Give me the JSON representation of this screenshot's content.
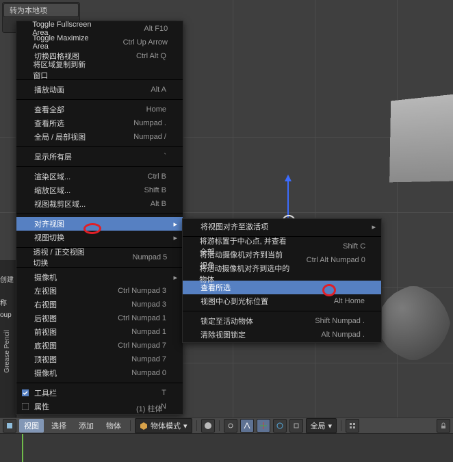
{
  "panel": {
    "title": "转为本地项"
  },
  "menu": {
    "items": [
      {
        "label": "Toggle Fullscreen Area",
        "shortcut": "Alt F10"
      },
      {
        "label": "Toggle Maximize Area",
        "shortcut": "Ctrl Up Arrow"
      },
      {
        "label": "切换四格视图",
        "shortcut": "Ctrl Alt Q"
      },
      {
        "label": "将区域复制到新窗口",
        "shortcut": ""
      },
      null,
      {
        "label": "播放动画",
        "shortcut": "Alt A"
      },
      null,
      {
        "label": "查看全部",
        "shortcut": "Home"
      },
      {
        "label": "查看所选",
        "shortcut": "Numpad ."
      },
      {
        "label": "全局 / 局部视图",
        "shortcut": "Numpad /"
      },
      null,
      {
        "label": "显示所有层",
        "shortcut": "`"
      },
      null,
      {
        "label": "渲染区域...",
        "shortcut": "Ctrl B"
      },
      {
        "label": "缩放区域...",
        "shortcut": "Shift B"
      },
      {
        "label": "视图裁剪区域...",
        "shortcut": "Alt B"
      },
      null,
      {
        "label": "对齐视图",
        "shortcut": "",
        "arrow": true,
        "highlight": true
      },
      {
        "label": "视图切换",
        "shortcut": "",
        "arrow": true
      },
      null,
      {
        "label": "透视 / 正交视图切换",
        "shortcut": "Numpad 5"
      },
      null,
      {
        "label": "摄像机",
        "shortcut": "",
        "arrow": true
      },
      {
        "label": "左视图",
        "shortcut": "Ctrl Numpad 3"
      },
      {
        "label": "右视图",
        "shortcut": "Numpad 3"
      },
      {
        "label": "后视图",
        "shortcut": "Ctrl Numpad 1"
      },
      {
        "label": "前视图",
        "shortcut": "Numpad 1"
      },
      {
        "label": "底视图",
        "shortcut": "Ctrl Numpad 7"
      },
      {
        "label": "顶视图",
        "shortcut": "Numpad 7"
      },
      {
        "label": "摄像机",
        "shortcut": "Numpad 0"
      },
      null,
      {
        "label": "工具栏",
        "shortcut": "T",
        "check": true
      },
      {
        "label": "属性",
        "shortcut": "N",
        "check": false
      }
    ]
  },
  "submenu": {
    "items": [
      {
        "label": "将视图对齐至激活项",
        "shortcut": "",
        "arrow": true
      },
      null,
      {
        "label": "将游标置于中心点, 并查看全部",
        "shortcut": "Shift C"
      },
      {
        "label": "将活动摄像机对齐到当前视角",
        "shortcut": "Ctrl Alt Numpad 0"
      },
      {
        "label": "将活动摄像机对齐到选中的物体",
        "shortcut": ""
      },
      {
        "label": "查看所选",
        "shortcut": "",
        "highlight": true
      },
      {
        "label": "视图中心到光标位置",
        "shortcut": "Alt Home"
      },
      null,
      {
        "label": "锁定至活动物体",
        "shortcut": "Shift Numpad ."
      },
      {
        "label": "清除视图锁定",
        "shortcut": "Alt Numpad ."
      }
    ]
  },
  "header": {
    "menus": [
      "视图",
      "选择",
      "添加",
      "物体"
    ],
    "mode": "物体模式",
    "orientation": "全局"
  },
  "side": {
    "create_label": "创建",
    "name_label": "称",
    "group_label": "oup"
  },
  "viewport_label": "(1) 柱体"
}
